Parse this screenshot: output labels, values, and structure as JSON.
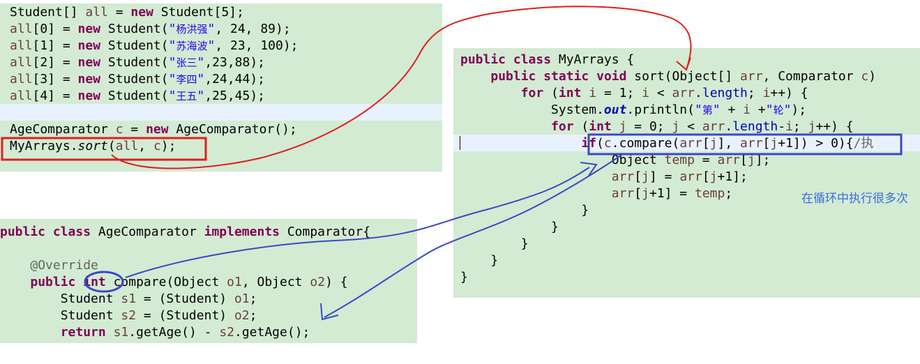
{
  "main_snippet": [
    [
      [
        "plain",
        "Student[] "
      ],
      [
        "var",
        "all"
      ],
      [
        "plain",
        " = "
      ],
      [
        "kw",
        "new"
      ],
      [
        "plain",
        " Student[5];"
      ]
    ],
    [
      [
        "var",
        "all"
      ],
      [
        "plain",
        "[0] = "
      ],
      [
        "kw",
        "new"
      ],
      [
        "plain",
        " Student("
      ],
      [
        "str",
        "\""
      ],
      [
        "strcjk",
        "杨洪强"
      ],
      [
        "str",
        "\""
      ],
      [
        "plain",
        ", 24, 89);"
      ]
    ],
    [
      [
        "var",
        "all"
      ],
      [
        "plain",
        "[1] = "
      ],
      [
        "kw",
        "new"
      ],
      [
        "plain",
        " Student("
      ],
      [
        "str",
        "\""
      ],
      [
        "strcjk",
        "苏海波"
      ],
      [
        "str",
        "\""
      ],
      [
        "plain",
        ", 23, 100);"
      ]
    ],
    [
      [
        "var",
        "all"
      ],
      [
        "plain",
        "[2] = "
      ],
      [
        "kw",
        "new"
      ],
      [
        "plain",
        " Student("
      ],
      [
        "str",
        "\""
      ],
      [
        "strcjk",
        "张三"
      ],
      [
        "str",
        "\""
      ],
      [
        "plain",
        ",23,88);"
      ]
    ],
    [
      [
        "var",
        "all"
      ],
      [
        "plain",
        "[3] = "
      ],
      [
        "kw",
        "new"
      ],
      [
        "plain",
        " Student("
      ],
      [
        "str",
        "\""
      ],
      [
        "strcjk",
        "李四"
      ],
      [
        "str",
        "\""
      ],
      [
        "plain",
        ",24,44);"
      ]
    ],
    [
      [
        "var",
        "all"
      ],
      [
        "plain",
        "[4] = "
      ],
      [
        "kw",
        "new"
      ],
      [
        "plain",
        " Student("
      ],
      [
        "str",
        "\""
      ],
      [
        "strcjk",
        "王五"
      ],
      [
        "str",
        "\""
      ],
      [
        "plain",
        ",25,45);"
      ]
    ],
    [],
    [
      [
        "plain",
        "AgeComparator "
      ],
      [
        "var",
        "c"
      ],
      [
        "plain",
        " = "
      ],
      [
        "kw",
        "new"
      ],
      [
        "plain",
        " AgeComparator();"
      ]
    ],
    [
      [
        "plain",
        "MyArrays."
      ],
      [
        "it",
        "sort"
      ],
      [
        "plain",
        "("
      ],
      [
        "var",
        "all"
      ],
      [
        "plain",
        ", "
      ],
      [
        "var",
        "c"
      ],
      [
        "plain",
        ");"
      ]
    ]
  ],
  "myarrays_snippet": [
    [
      [
        "kw",
        "public"
      ],
      [
        "plain",
        " "
      ],
      [
        "kw",
        "class"
      ],
      [
        "plain",
        " MyArrays {"
      ]
    ],
    [
      [
        "plain",
        "    "
      ],
      [
        "kw",
        "public"
      ],
      [
        "plain",
        " "
      ],
      [
        "kw",
        "static"
      ],
      [
        "plain",
        " "
      ],
      [
        "kw",
        "void"
      ],
      [
        "plain",
        " sort(Object[] "
      ],
      [
        "var",
        "arr"
      ],
      [
        "plain",
        ", Comparator "
      ],
      [
        "var",
        "c"
      ],
      [
        "plain",
        ")"
      ]
    ],
    [
      [
        "plain",
        "        "
      ],
      [
        "kw",
        "for"
      ],
      [
        "plain",
        " ("
      ],
      [
        "kw",
        "int"
      ],
      [
        "plain",
        " "
      ],
      [
        "var",
        "i"
      ],
      [
        "plain",
        " = 1; "
      ],
      [
        "var",
        "i"
      ],
      [
        "plain",
        " < "
      ],
      [
        "var",
        "arr"
      ],
      [
        "plain",
        "."
      ],
      [
        "fld",
        "length"
      ],
      [
        "plain",
        "; "
      ],
      [
        "var",
        "i"
      ],
      [
        "plain",
        "++) {"
      ]
    ],
    [
      [
        "plain",
        "            System."
      ],
      [
        "out",
        "out"
      ],
      [
        "plain",
        ".println("
      ],
      [
        "str",
        "\""
      ],
      [
        "strcjk",
        "第"
      ],
      [
        "str",
        "\""
      ],
      [
        "plain",
        " + "
      ],
      [
        "var",
        "i"
      ],
      [
        "plain",
        " +"
      ],
      [
        "str",
        "\""
      ],
      [
        "strcjk",
        "轮"
      ],
      [
        "str",
        "\""
      ],
      [
        "plain",
        ");"
      ]
    ],
    [
      [
        "plain",
        "            "
      ],
      [
        "kw",
        "for"
      ],
      [
        "plain",
        " ("
      ],
      [
        "kw",
        "int"
      ],
      [
        "plain",
        " "
      ],
      [
        "var",
        "j"
      ],
      [
        "plain",
        " = 0; "
      ],
      [
        "var",
        "j"
      ],
      [
        "plain",
        " < "
      ],
      [
        "var",
        "arr"
      ],
      [
        "plain",
        "."
      ],
      [
        "fld",
        "length"
      ],
      [
        "plain",
        "-"
      ],
      [
        "var",
        "i"
      ],
      [
        "plain",
        "; "
      ],
      [
        "var",
        "j"
      ],
      [
        "plain",
        "++) {"
      ]
    ],
    [
      [
        "plain",
        "                "
      ],
      [
        "kw",
        "if"
      ],
      [
        "plain",
        "("
      ],
      [
        "var",
        "c"
      ],
      [
        "plain",
        ".compare("
      ],
      [
        "var",
        "arr"
      ],
      [
        "plain",
        "["
      ],
      [
        "var",
        "j"
      ],
      [
        "plain",
        "], "
      ],
      [
        "var",
        "arr"
      ],
      [
        "plain",
        "["
      ],
      [
        "var",
        "j"
      ],
      [
        "plain",
        "+1]) > 0){"
      ],
      [
        "ann",
        "/执"
      ]
    ],
    [
      [
        "plain",
        "                    Object "
      ],
      [
        "var",
        "temp"
      ],
      [
        "plain",
        " = "
      ],
      [
        "var",
        "arr"
      ],
      [
        "plain",
        "["
      ],
      [
        "var",
        "j"
      ],
      [
        "plain",
        "];"
      ]
    ],
    [
      [
        "plain",
        "                    "
      ],
      [
        "var",
        "arr"
      ],
      [
        "plain",
        "["
      ],
      [
        "var",
        "j"
      ],
      [
        "plain",
        "] = "
      ],
      [
        "var",
        "arr"
      ],
      [
        "plain",
        "["
      ],
      [
        "var",
        "j"
      ],
      [
        "plain",
        "+1];"
      ]
    ],
    [
      [
        "plain",
        "                    "
      ],
      [
        "var",
        "arr"
      ],
      [
        "plain",
        "["
      ],
      [
        "var",
        "j"
      ],
      [
        "plain",
        "+1] = "
      ],
      [
        "var",
        "temp"
      ],
      [
        "plain",
        ";"
      ]
    ],
    [
      [
        "plain",
        "                }"
      ]
    ],
    [
      [
        "plain",
        "            }"
      ]
    ],
    [
      [
        "plain",
        "        }"
      ]
    ],
    [
      [
        "plain",
        "    }"
      ]
    ],
    [
      [
        "plain",
        "}"
      ]
    ]
  ],
  "comparator_snippet": [
    [
      [
        "kw",
        "public"
      ],
      [
        "plain",
        " "
      ],
      [
        "kw",
        "class"
      ],
      [
        "plain",
        " AgeComparator "
      ],
      [
        "kw",
        "implements"
      ],
      [
        "plain",
        " Comparator{"
      ]
    ],
    [],
    [
      [
        "plain",
        "    "
      ],
      [
        "ann",
        "@Override"
      ]
    ],
    [
      [
        "plain",
        "    "
      ],
      [
        "kw",
        "public"
      ],
      [
        "plain",
        " "
      ],
      [
        "kw",
        "int"
      ],
      [
        "plain",
        " compare(Object "
      ],
      [
        "var",
        "o1"
      ],
      [
        "plain",
        ", Object "
      ],
      [
        "var",
        "o2"
      ],
      [
        "plain",
        ") {"
      ]
    ],
    [
      [
        "plain",
        "        Student "
      ],
      [
        "var",
        "s1"
      ],
      [
        "plain",
        " = (Student) "
      ],
      [
        "var",
        "o1"
      ],
      [
        "plain",
        ";"
      ]
    ],
    [
      [
        "plain",
        "        Student "
      ],
      [
        "var",
        "s2"
      ],
      [
        "plain",
        " = (Student) "
      ],
      [
        "var",
        "o2"
      ],
      [
        "plain",
        ";"
      ]
    ],
    [
      [
        "plain",
        "        "
      ],
      [
        "kw",
        "return"
      ],
      [
        "plain",
        " "
      ],
      [
        "var",
        "s1"
      ],
      [
        "plain",
        ".getAge() - "
      ],
      [
        "var",
        "s2"
      ],
      [
        "plain",
        ".getAge();"
      ]
    ]
  ],
  "annotation_note": "在循环中执行很多次",
  "colors": {
    "panel_bg": "#d2ebd2",
    "keyword": "#7f0055",
    "string": "#2a00ff",
    "variable": "#6a3e3e",
    "red_mark": "#e01e1e",
    "blue_mark": "#3a48c8"
  }
}
